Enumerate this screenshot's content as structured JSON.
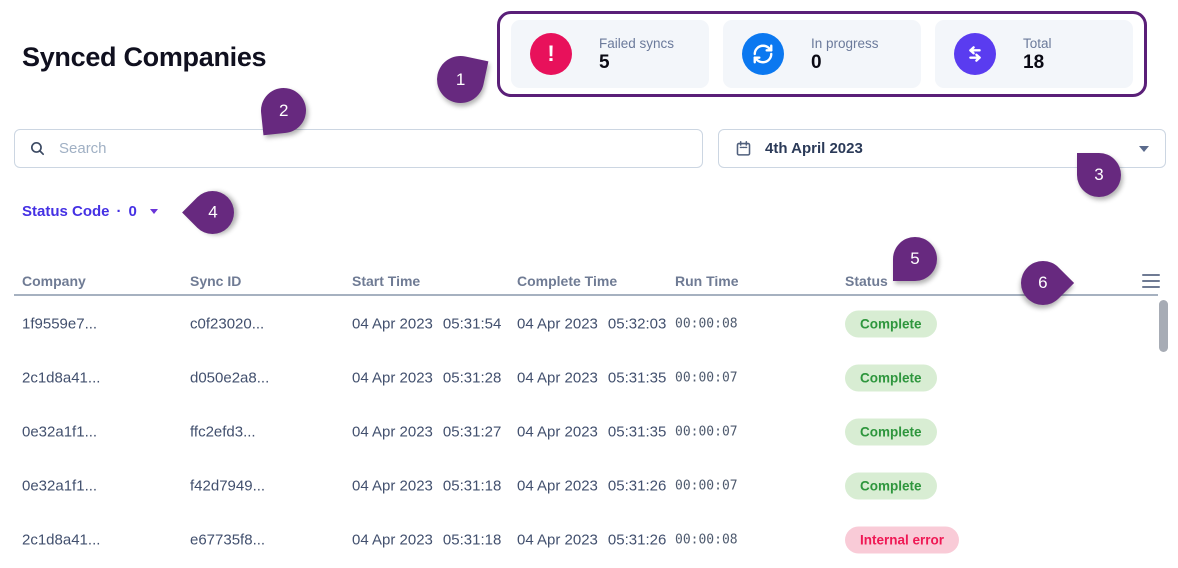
{
  "page_title": "Synced Companies",
  "stats": {
    "cards": [
      {
        "label": "Failed syncs",
        "value": "5",
        "icon": "alert-icon",
        "icon_color": "#e8115b"
      },
      {
        "label": "In progress",
        "value": "0",
        "icon": "sync-icon",
        "icon_color": "#0b78f0"
      },
      {
        "label": "Total",
        "value": "18",
        "icon": "transfer-arrows-icon",
        "icon_color": "#5a3cf0"
      }
    ],
    "alert_glyph": "!"
  },
  "search": {
    "placeholder": "Search",
    "icon": "search-icon"
  },
  "date_picker": {
    "value": "4th April 2023",
    "icon": "calendar-icon"
  },
  "filters": {
    "status_code": {
      "label": "Status Code",
      "separator": "·",
      "count": "0"
    }
  },
  "callouts": {
    "c1": "1",
    "c2": "2",
    "c3": "3",
    "c4": "4",
    "c5": "5",
    "c6": "6"
  },
  "table": {
    "columns": [
      "Company",
      "Sync ID",
      "Start Time",
      "Complete Time",
      "Run Time",
      "Status"
    ],
    "rows": [
      {
        "company": "1f9559e7...",
        "sync_id": "c0f23020...",
        "start_date": "04 Apr 2023",
        "start_time": "05:31:54",
        "complete_date": "04 Apr 2023",
        "complete_time": "05:32:03",
        "run_time": "00:00:08",
        "status": "Complete",
        "status_type": "success"
      },
      {
        "company": "2c1d8a41...",
        "sync_id": "d050e2a8...",
        "start_date": "04 Apr 2023",
        "start_time": "05:31:28",
        "complete_date": "04 Apr 2023",
        "complete_time": "05:31:35",
        "run_time": "00:00:07",
        "status": "Complete",
        "status_type": "success"
      },
      {
        "company": "0e32a1f1...",
        "sync_id": "ffc2efd3...",
        "start_date": "04 Apr 2023",
        "start_time": "05:31:27",
        "complete_date": "04 Apr 2023",
        "complete_time": "05:31:35",
        "run_time": "00:00:07",
        "status": "Complete",
        "status_type": "success"
      },
      {
        "company": "0e32a1f1...",
        "sync_id": "f42d7949...",
        "start_date": "04 Apr 2023",
        "start_time": "05:31:18",
        "complete_date": "04 Apr 2023",
        "complete_time": "05:31:26",
        "run_time": "00:00:07",
        "status": "Complete",
        "status_type": "success"
      },
      {
        "company": "2c1d8a41...",
        "sync_id": "e67735f8...",
        "start_date": "04 Apr 2023",
        "start_time": "05:31:18",
        "complete_date": "04 Apr 2023",
        "complete_time": "05:31:26",
        "run_time": "00:00:08",
        "status": "Internal error",
        "status_type": "error"
      }
    ]
  },
  "colors": {
    "highlight_border": "#5a1f78",
    "callout": "#67297f",
    "failed_icon": "#e8115b",
    "progress_icon": "#0b78f0",
    "total_icon": "#5a3cf0",
    "badge_success_bg": "#d8edd3",
    "badge_success_text": "#2e963d",
    "badge_error_bg": "#f9cbd7",
    "badge_error_text": "#ef1854",
    "filter_accent": "#4531e4"
  }
}
